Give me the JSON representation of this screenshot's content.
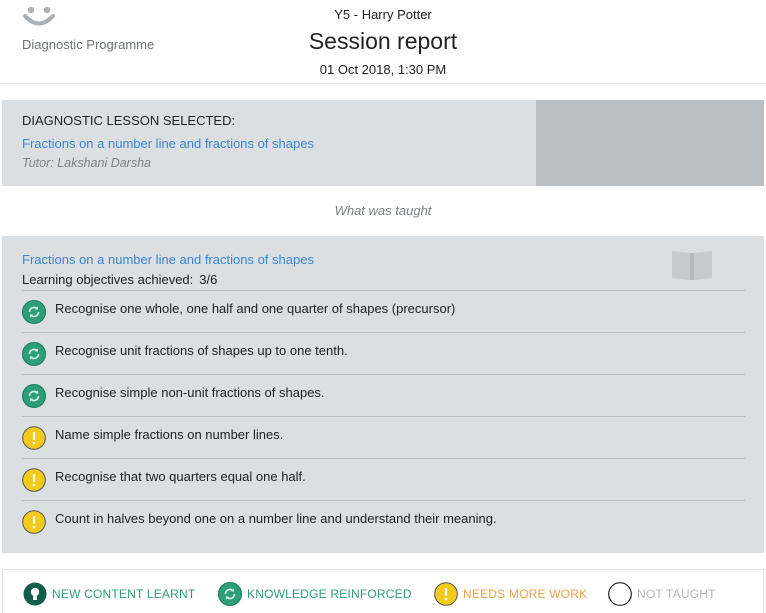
{
  "header": {
    "brand": "Diagnostic Programme",
    "student": "Y5 - Harry Potter",
    "title": "Session report",
    "date": "01 Oct 2018, 1:30 PM"
  },
  "lesson": {
    "heading": "DIAGNOSTIC LESSON SELECTED:",
    "name": "Fractions on a number line and fractions of shapes",
    "tutor": "Tutor: Lakshani Darsha"
  },
  "section_label": "What was taught",
  "objectives": {
    "title": "Fractions on a number line and fractions of shapes",
    "achieved_label": "Learning objectives achieved:",
    "achieved_value": "3/6",
    "items": [
      {
        "text": "Recognise one whole, one half and one quarter of shapes (precursor)",
        "status": "reinforced"
      },
      {
        "text": "Recognise unit fractions of shapes up to one tenth.",
        "status": "reinforced"
      },
      {
        "text": "Recognise simple non-unit fractions of shapes.",
        "status": "reinforced"
      },
      {
        "text": "Name simple fractions on number lines.",
        "status": "needs-work"
      },
      {
        "text": "Recognise that two quarters equal one half.",
        "status": "needs-work"
      },
      {
        "text": "Count in halves beyond one on a number line and understand their meaning.",
        "status": "needs-work"
      }
    ]
  },
  "legend": {
    "new": "NEW CONTENT LEARNT",
    "reinforced": "KNOWLEDGE REINFORCED",
    "needs_work": "NEEDS MORE WORK",
    "not_taught": "NOT TAUGHT"
  },
  "colors": {
    "accent_link": "#3a86d2",
    "new": "#0f5e4a",
    "reinforced": "#2e9e79",
    "needs_work": "#f2cb1d",
    "needs_work_text": "#f0a046",
    "not_taught_text": "#b3b7bb",
    "panel": "#dcdfe2"
  },
  "icons": {
    "logo": "smile-logo-icon",
    "book": "book-icon",
    "reinforced": "refresh-icon",
    "needs_work": "exclamation-icon",
    "new": "lightbulb-icon",
    "not_taught": "empty-circle-icon"
  }
}
